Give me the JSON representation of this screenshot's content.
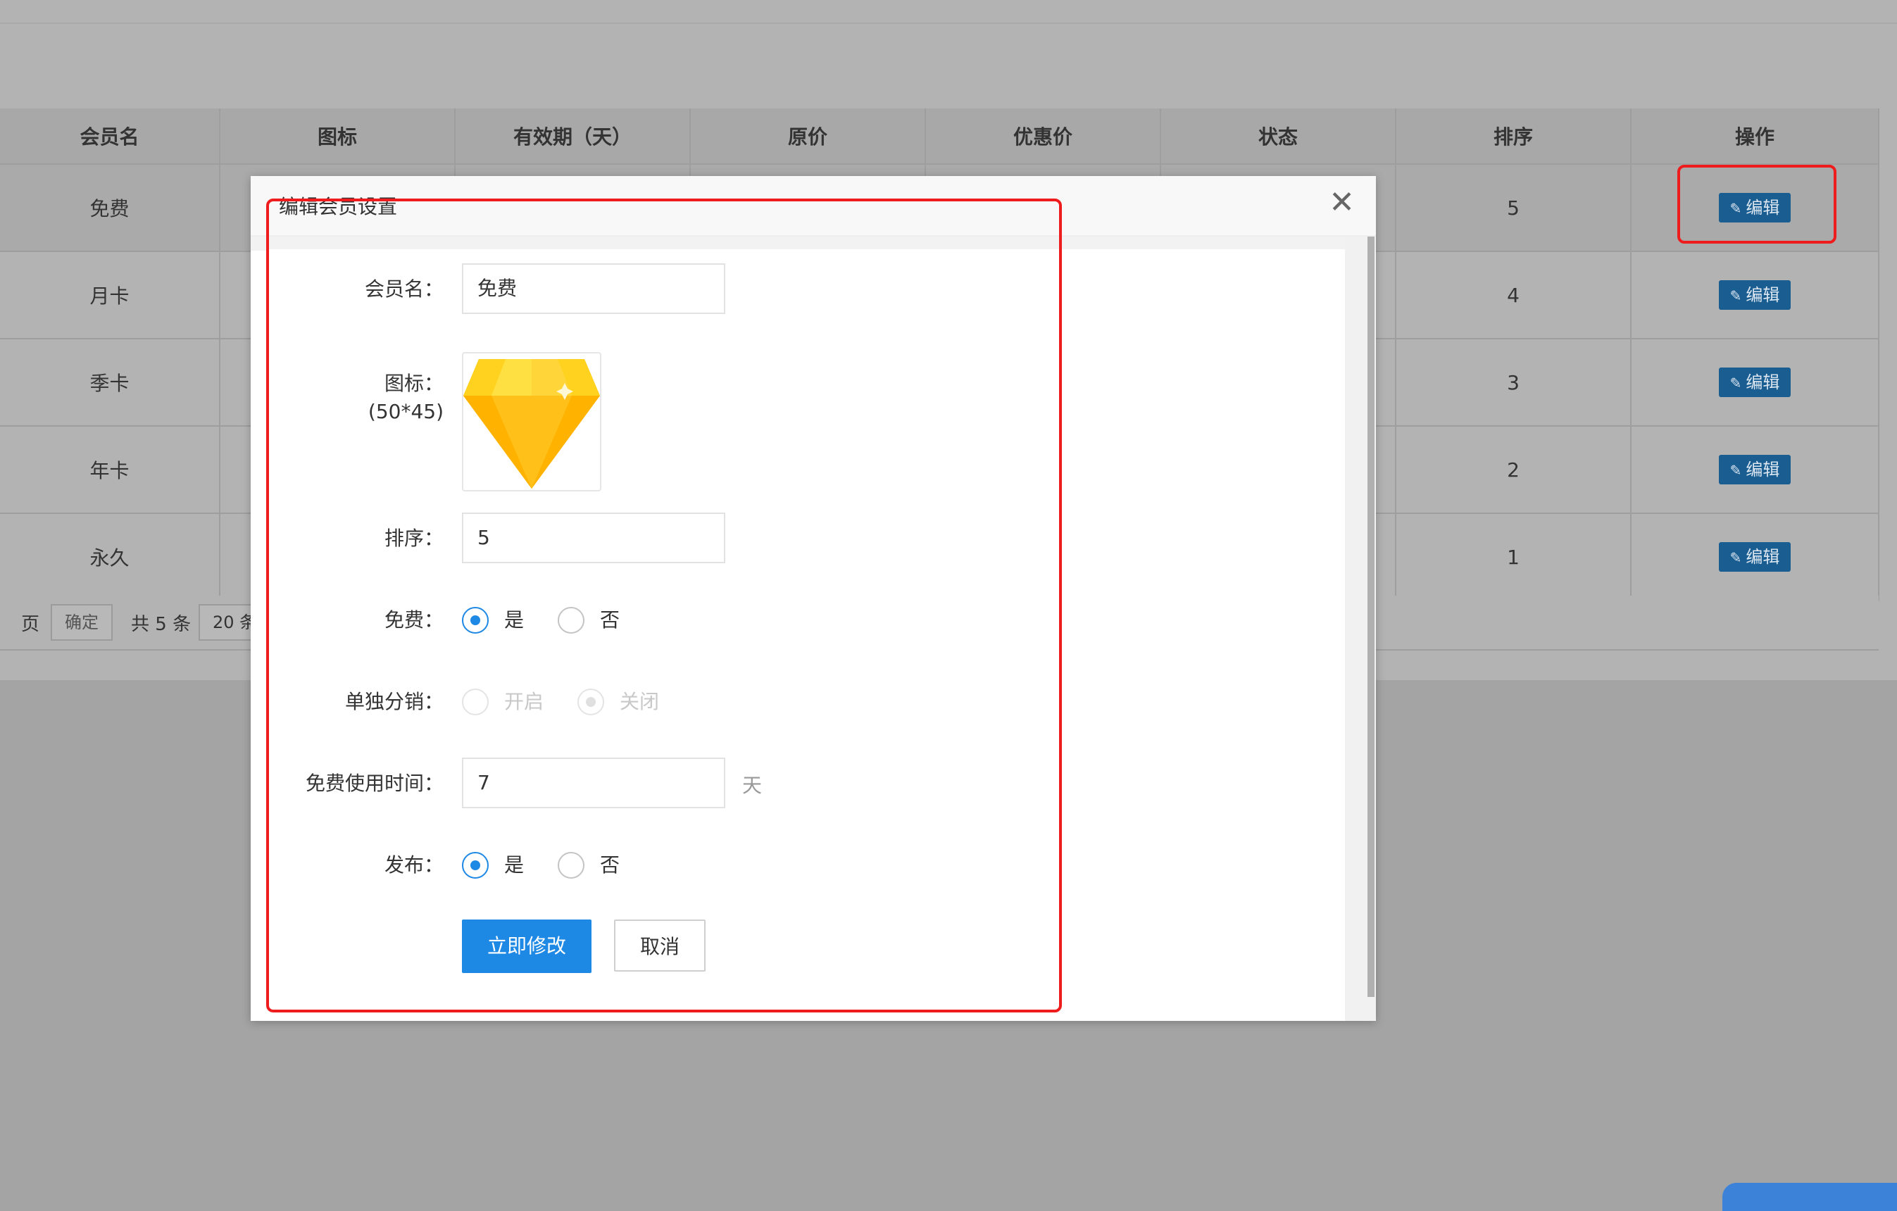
{
  "table": {
    "headers": [
      "会员名",
      "图标",
      "有效期（天）",
      "原价",
      "优惠价",
      "状态",
      "排序",
      "操作"
    ],
    "rows": [
      {
        "name": "免费",
        "sort": "5",
        "action": "编辑"
      },
      {
        "name": "月卡",
        "sort": "4",
        "action": "编辑"
      },
      {
        "name": "季卡",
        "sort": "3",
        "action": "编辑"
      },
      {
        "name": "年卡",
        "sort": "2",
        "action": "编辑"
      },
      {
        "name": "永久",
        "sort": "1",
        "action": "编辑"
      }
    ]
  },
  "pagination": {
    "page_label": "页",
    "confirm": "确定",
    "total": "共 5 条",
    "page_size": "20 条/"
  },
  "modal": {
    "title": "编辑会员设置",
    "close_icon": "close-icon",
    "fields": {
      "name_label": "会员名：",
      "name_value": "免费",
      "icon_label": "图标：",
      "icon_hint": "(50*45)",
      "icon_name": "diamond-icon",
      "sort_label": "排序：",
      "sort_value": "5",
      "free_label": "免费：",
      "free_yes": "是",
      "free_no": "否",
      "distribution_label": "单独分销：",
      "distribution_on": "开启",
      "distribution_off": "关闭",
      "free_time_label": "免费使用时间：",
      "free_time_value": "7",
      "free_time_unit": "天",
      "publish_label": "发布：",
      "publish_yes": "是",
      "publish_no": "否"
    },
    "buttons": {
      "submit": "立即修改",
      "cancel": "取消"
    }
  },
  "colors": {
    "primary": "#1e88e5",
    "highlight": "#ee1c1c",
    "overlay": "#a4a4a4"
  }
}
